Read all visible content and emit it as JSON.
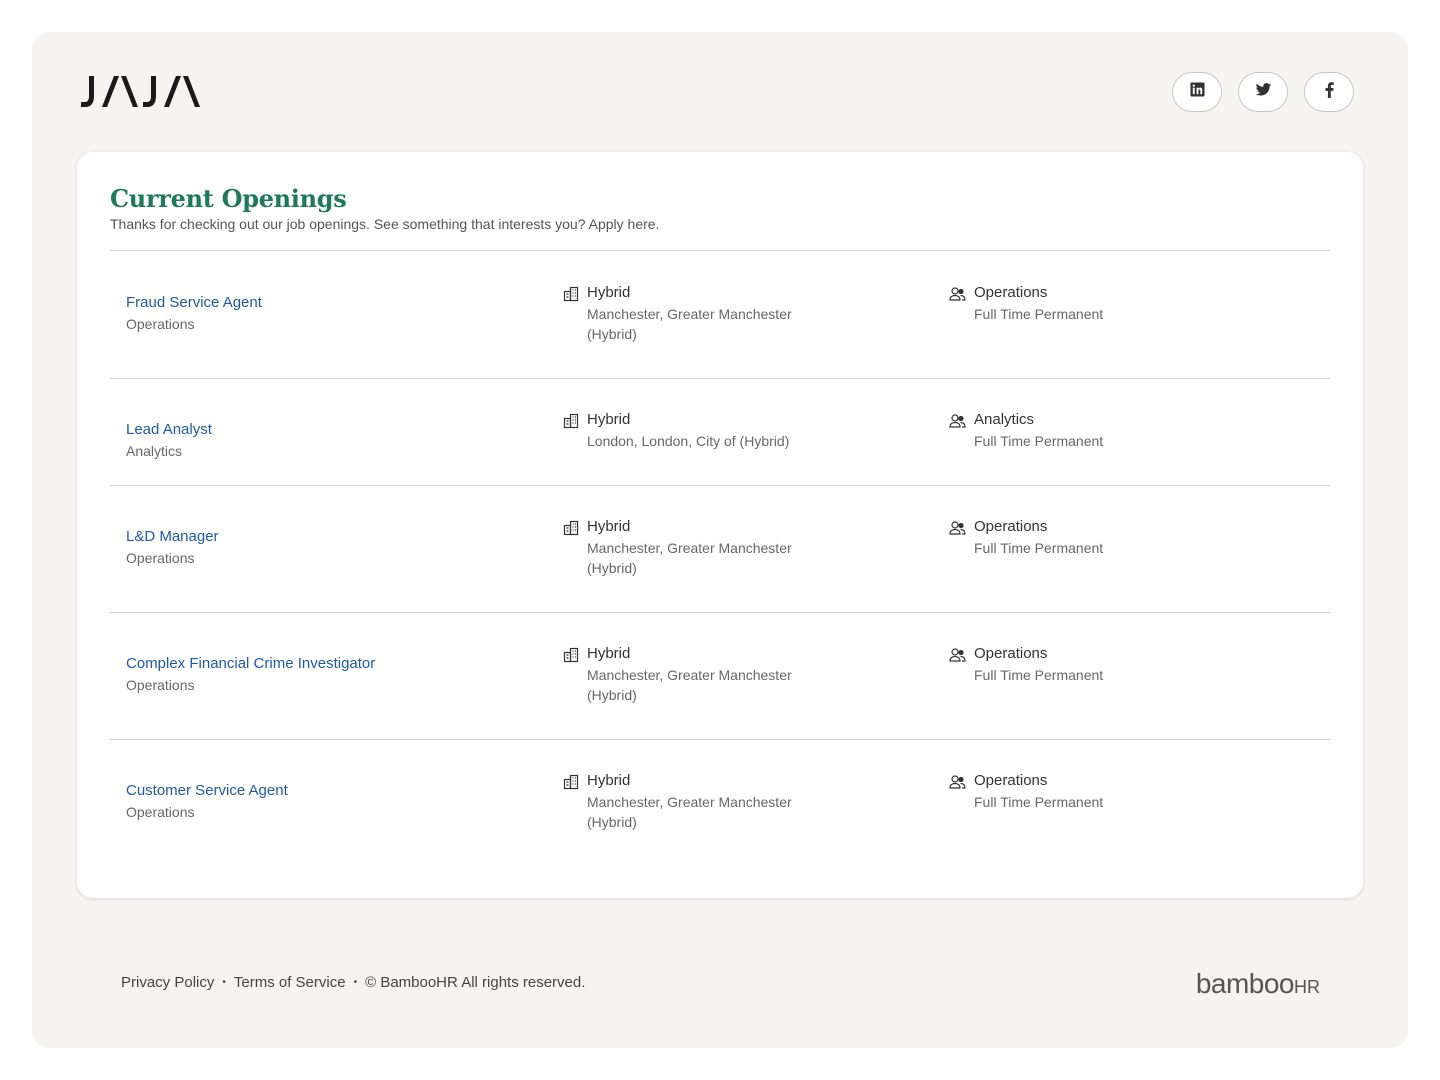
{
  "brand": {
    "logo_text": "JAJA"
  },
  "social": [
    {
      "name": "linkedin",
      "icon": "linkedin-icon"
    },
    {
      "name": "twitter",
      "icon": "twitter-icon"
    },
    {
      "name": "facebook",
      "icon": "facebook-icon"
    }
  ],
  "header": {
    "title": "Current Openings",
    "subtitle": "Thanks for checking out our job openings. See something that interests you? Apply here."
  },
  "jobs": [
    {
      "title": "Fraud Service Agent",
      "department": "Operations",
      "location_type": "Hybrid",
      "location": "Manchester, Greater Manchester (Hybrid)",
      "location_line1": "Manchester, Greater Manchester",
      "location_line2": "(Hybrid)",
      "team": "Operations",
      "employment": "Full Time Permanent"
    },
    {
      "title": "Lead Analyst",
      "department": "Analytics",
      "location_type": "Hybrid",
      "location": "London, London, City of (Hybrid)",
      "location_line1": "London, London, City of (Hybrid)",
      "location_line2": "",
      "team": "Analytics",
      "employment": "Full Time Permanent"
    },
    {
      "title": "L&D Manager",
      "department": "Operations",
      "location_type": "Hybrid",
      "location": "Manchester, Greater Manchester (Hybrid)",
      "location_line1": "Manchester, Greater Manchester",
      "location_line2": "(Hybrid)",
      "team": "Operations",
      "employment": "Full Time Permanent"
    },
    {
      "title": "Complex Financial Crime Investigator",
      "department": "Operations",
      "location_type": "Hybrid",
      "location": "Manchester, Greater Manchester (Hybrid)",
      "location_line1": "Manchester, Greater Manchester",
      "location_line2": "(Hybrid)",
      "team": "Operations",
      "employment": "Full Time Permanent"
    },
    {
      "title": "Customer Service Agent",
      "department": "Operations",
      "location_type": "Hybrid",
      "location": "Manchester, Greater Manchester (Hybrid)",
      "location_line1": "Manchester, Greater Manchester",
      "location_line2": "(Hybrid)",
      "team": "Operations",
      "employment": "Full Time Permanent"
    }
  ],
  "footer": {
    "privacy": "Privacy Policy",
    "terms": "Terms of Service",
    "copyright": "© BambooHR All rights reserved.",
    "separator": "•",
    "powered_by": "bambooHR",
    "powered_by_main": "bamboo",
    "powered_by_suffix": "HR"
  },
  "colors": {
    "accent": "#1f7a5c",
    "link": "#1e5aa6",
    "background": "#f5f4f1"
  }
}
